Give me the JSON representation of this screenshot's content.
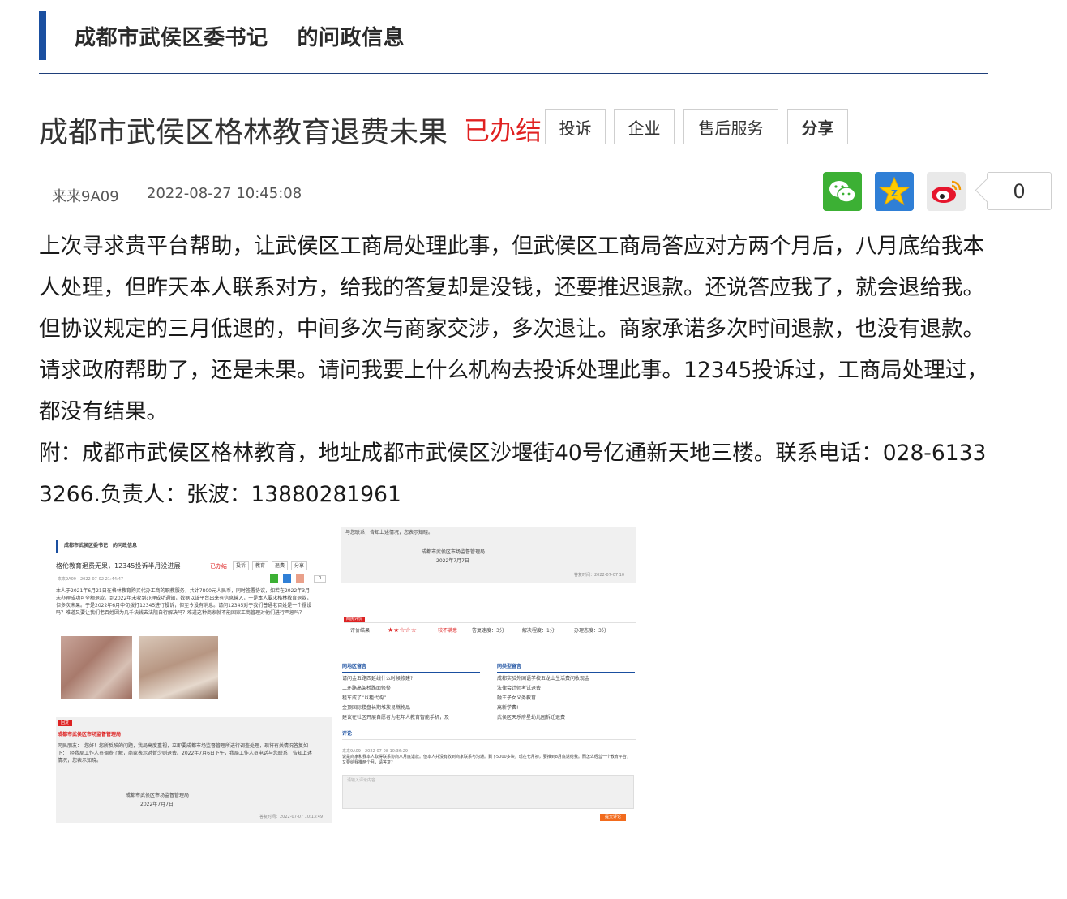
{
  "section": {
    "title": "成都市武侯区委书记　 的问政信息"
  },
  "post": {
    "title": "成都市武侯区格林教育退费未果",
    "status": "已办结",
    "tags": [
      "投诉",
      "企业",
      "售后服务"
    ],
    "share_label": "分享",
    "author": "来来9A09",
    "datetime": "2022-08-27 10:45:08",
    "share_count": "0",
    "paragraphs": [
      "上次寻求贵平台帮助，让武侯区工商局处理此事，但武侯区工商局答应对方两个月后，八月底给我本人处理，但昨天本人联系对方，给我的答复却是没钱，还要推迟退款。还说答应我了，就会退给我。但协议规定的三月低退的，中间多次与商家交涉，多次退让。商家承诺多次时间退款，也没有退款。请求政府帮助了，还是未果。请问我要上什么机构去投诉处理此事。12345投诉过，工商局处理过，都没有结果。",
      "附：成都市武侯区格林教育，地址成都市武侯区沙堰街40号亿通新天地三楼。联系电话：028-61333266.负责人：张波：13880281961"
    ]
  },
  "screenshot": {
    "header": "成都市武侯区委书记　的问政信息",
    "title": "格伦教育退费无果，12345投诉半月没进展",
    "status": "已办结",
    "tags": [
      "投诉",
      "教育",
      "退费",
      "分享"
    ],
    "meta": "来来9A09　2022-07-02 21:44:47",
    "count": "0",
    "body": "本人于2021年6月21日在格林教育购买代办工商的职教服务，共计7800元人民币，同时签署协议，如若在2022年3月未办理成功可全额退款。到2022年未收到办理成功通知，数据以该平台出来有信息输入，于是本人要求格林教育退款，但多次未果。于是2022年6月中旬拨打12345进行投诉，但至今没有消息。请问12345对于我们普通老百姓是一个摆设吗？难道又要让我们老百姓因为几千块钱去法院自行解决吗？难道这种商家就不能国家工商管理对他们进行严惩吗？",
    "reply_badge": "回复",
    "reply_org": "成都市武侯区市场监督管理局",
    "reply_text": "网民朋友：　您好！您所反映的问题，我局高度重视，立即要成都市场监督管理所进行调查处理，现将有关情况答复如下：　经我局工作人员调查了解，商家表示对暂少则退费。2022年7月6日下午，我局工作人员电话与您联系，告知上述情况，您表示知晓。",
    "reply_sign": "成都市武侯区市场监督管理局",
    "reply_date": "2022年7月7日",
    "reply_time": "答复时间：2022-07-07 10:13:49",
    "reply_text_top": "与您联系，告知上述情况，您表示知晓。",
    "reply_time_top": "答复时间：2022-07-07 10",
    "eval_badge": "网民评价",
    "eval_label": "评价结果：",
    "eval_stars": "★★☆☆☆",
    "eval_level": "较不满意",
    "eval_items": [
      "答复速度：3分",
      "解决程度：1分",
      "办理态度：3分"
    ],
    "same_area_title": "同地区留言",
    "same_area": [
      "请问金五路西延线什么时候修建?",
      "二环路高架桥路面修整",
      "租车成了“以租代购”",
      "金顶国际楼盘长期堆放易燃物品",
      "建议在社区开展自愿者为老年人教育智能手机，及"
    ],
    "same_type_title": "同类型留言",
    "same_type": [
      "成都实验外国语学校五龙山生活费问收现金",
      "法律会计师考试退费",
      "融王子女义务教育",
      "高新学费!",
      "武侯区天乐府星幼儿园拆迁退费"
    ],
    "comment_title": "评论",
    "comment_meta": "来来9A09　2022-07-08 10:36:29",
    "comment_text": "说是商家和我本人取得联系协商八月底退款。但本人并没有收到商家联系与沟通。剩下5000多块，现在七月初，要推到8月底退给我。而怎么经营一个教育平台，又要给我推两个月，请答复?",
    "comment_placeholder": "请输入评论内容",
    "comment_submit": "提交评论"
  }
}
